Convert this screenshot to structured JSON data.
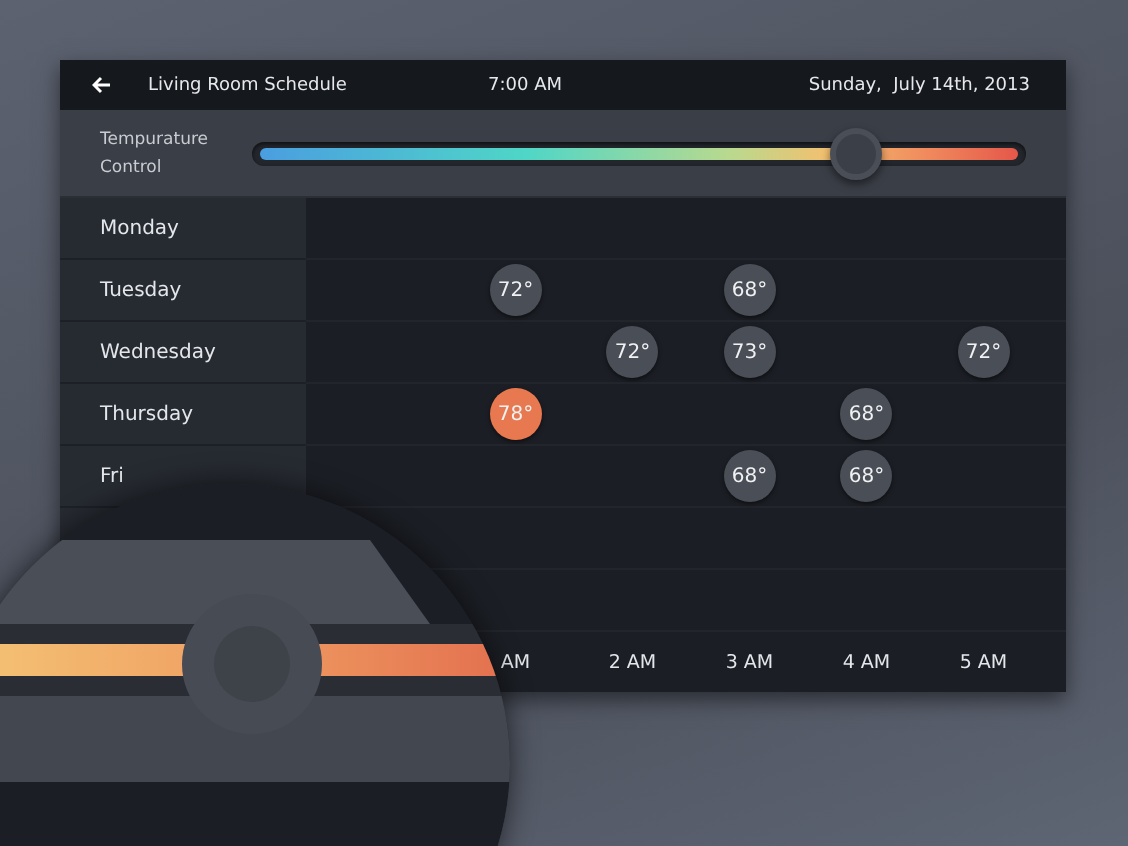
{
  "header": {
    "title": "Living Room Schedule",
    "time": "7:00 AM",
    "date": "Sunday,  July 14th, 2013"
  },
  "temperature_control": {
    "label": "Tempurature Control",
    "level": 0.78
  },
  "schedule": {
    "rows": [
      {
        "day": "Monday",
        "slots": [
          {
            "filled": false
          },
          {
            "filled": false
          },
          {
            "filled": false
          },
          {
            "filled": false
          },
          {
            "filled": false
          },
          {
            "filled": false
          }
        ]
      },
      {
        "day": "Tuesday",
        "slots": [
          {
            "filled": false
          },
          {
            "filled": true,
            "temp": "72°",
            "active": false
          },
          {
            "filled": false
          },
          {
            "filled": true,
            "temp": "68°",
            "active": false
          },
          {
            "filled": false
          },
          {
            "filled": false
          }
        ]
      },
      {
        "day": "Wednesday",
        "slots": [
          {
            "filled": false
          },
          {
            "filled": false
          },
          {
            "filled": true,
            "temp": "72°",
            "active": false
          },
          {
            "filled": true,
            "temp": "73°",
            "active": false
          },
          {
            "filled": false
          },
          {
            "filled": true,
            "temp": "72°",
            "active": false
          }
        ]
      },
      {
        "day": "Thursday",
        "slots": [
          {
            "filled": false
          },
          {
            "filled": true,
            "temp": "78°",
            "active": true
          },
          {
            "filled": false
          },
          {
            "filled": false
          },
          {
            "filled": true,
            "temp": "68°",
            "active": false
          },
          {
            "filled": false
          }
        ]
      },
      {
        "day": "Fri",
        "slots": [
          {
            "filled": false
          },
          {
            "filled": false
          },
          {
            "filled": false
          },
          {
            "filled": true,
            "temp": "68°",
            "active": false
          },
          {
            "filled": true,
            "temp": "68°",
            "active": false
          },
          {
            "filled": false
          }
        ]
      },
      {
        "slots": [
          {
            "filled": false
          },
          {
            "filled": false
          },
          {
            "filled": false
          },
          {
            "filled": false
          },
          {
            "filled": false
          },
          {
            "filled": false
          }
        ]
      },
      {
        "slots": [
          {
            "filled": false
          },
          {
            "filled": false
          },
          {
            "filled": false
          },
          {
            "filled": false
          },
          {
            "filled": false
          },
          {
            "filled": false
          }
        ]
      }
    ],
    "time_axis": [
      "AM",
      "2 AM",
      "3 AM",
      "4 AM",
      "5 AM"
    ]
  }
}
